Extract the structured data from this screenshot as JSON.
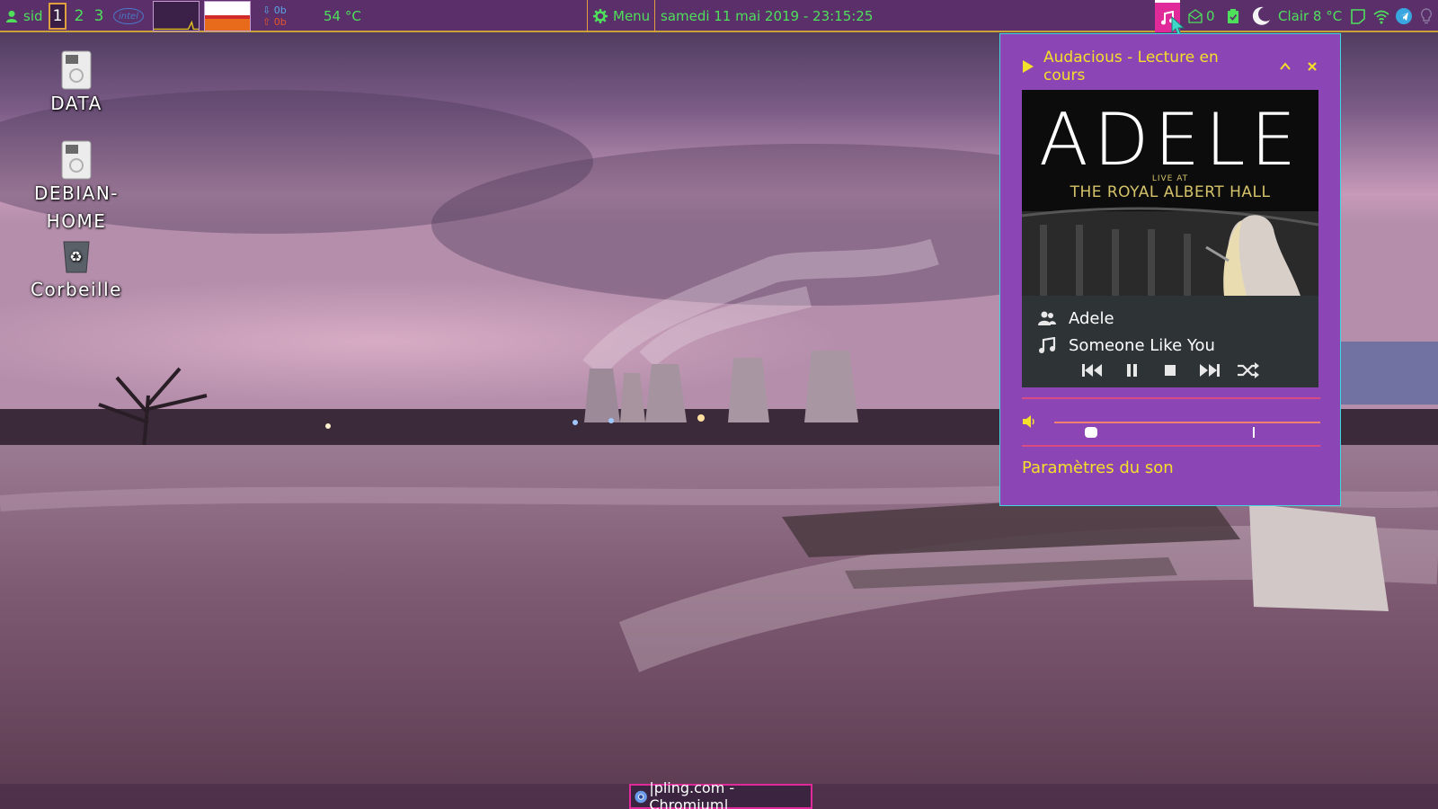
{
  "panel": {
    "user": "sid",
    "workspaces": [
      "1",
      "2",
      "3"
    ],
    "cpu_label": "intel",
    "net_up": "0b",
    "net_down": "0b",
    "temperature": "54 °C",
    "menu_label": "Menu",
    "datetime": "samedi 11 mai 2019 - 23:15:25",
    "mail_count": "0",
    "weather": "Clair 8 °C"
  },
  "desktop_icons": [
    {
      "label": "DATA",
      "icon": "drive-icon"
    },
    {
      "label": "DEBIAN-HOME",
      "icon": "drive-icon"
    },
    {
      "label": "Corbeille",
      "icon": "trash-icon"
    }
  ],
  "player": {
    "header_title": "Audacious - Lecture en cours",
    "cover_artist": "ADELE",
    "cover_live_at": "LIVE AT",
    "cover_venue": "THE ROYAL ALBERT HALL",
    "artist": "Adele",
    "track": "Someone Like You",
    "volume": 0.14,
    "sound_settings_label": "Paramètres du son"
  },
  "taskbar": {
    "task_label": "|pling.com - Chromium|"
  },
  "colors": {
    "panel_bg": "#5a2f6a",
    "panel_text": "#4ee05a",
    "accent_yellow": "#f2e02a",
    "popup_bg": "#8c45b4",
    "popup_border": "#3fd8e0",
    "active_tray": "#e02a9a"
  }
}
